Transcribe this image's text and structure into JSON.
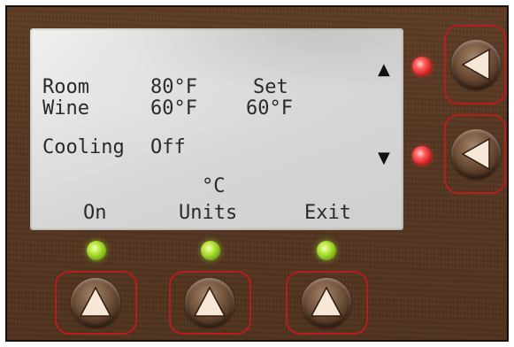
{
  "display": {
    "row_room_label": "Room",
    "row_room_value": "80°F",
    "row_set_label": "Set",
    "row_wine_label": "Wine",
    "row_wine_value": "60°F",
    "row_set_value": "60°F",
    "status_label": "Cooling",
    "status_value": "Off",
    "units_hint": "°C",
    "softkey_left": "On",
    "softkey_middle": "Units",
    "softkey_right": "Exit",
    "scroll_up": "▲",
    "scroll_down": "▼"
  },
  "indicators": {
    "side_led_color": "#ff4a4a",
    "bottom_led_color": "#9ad62a"
  },
  "colors": {
    "panel": "#54351f",
    "button_frame": "#b81c1c",
    "button_arrow": "#f6e7d6"
  },
  "icons": {
    "side_buttons": "left-triangle-icon",
    "bottom_buttons": "up-triangle-icon"
  }
}
